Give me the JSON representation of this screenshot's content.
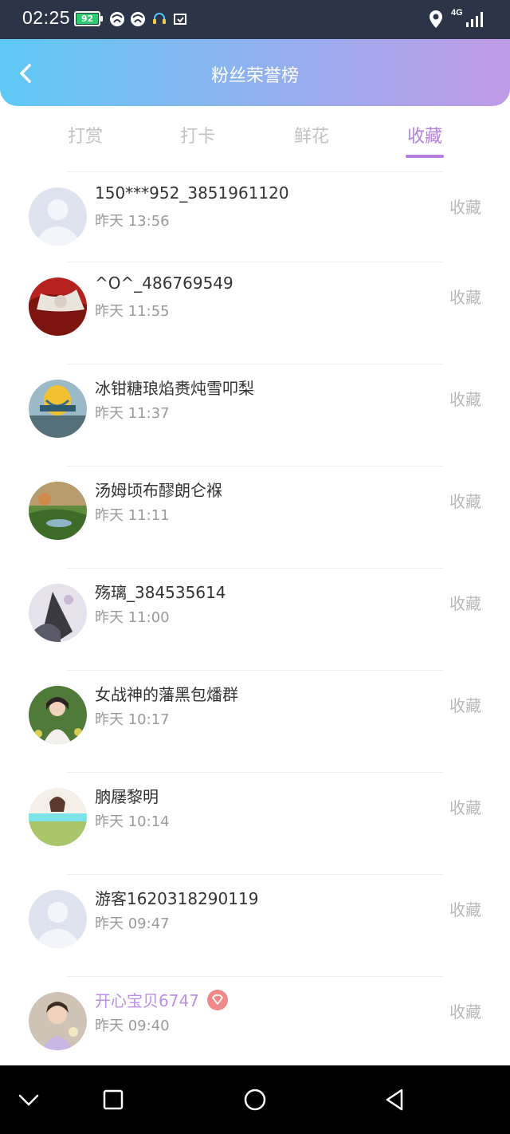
{
  "status_bar": {
    "time": "02:25",
    "battery_level": "92",
    "network": "4G",
    "battery_color": "#2ecc71"
  },
  "header": {
    "title": "粉丝荣誉榜",
    "gradient": [
      "#5ec9f4",
      "#8fb1ef",
      "#c09ae8"
    ]
  },
  "tabs": [
    {
      "label": "打赏",
      "active": false
    },
    {
      "label": "打卡",
      "active": false
    },
    {
      "label": "鲜花",
      "active": false
    },
    {
      "label": "收藏",
      "active": true
    }
  ],
  "accent_color": "#b57fe2",
  "list": [
    {
      "name": "150***952_3851961120",
      "time": "昨天 13:56",
      "action": "收藏",
      "avatar": "default-avatar"
    },
    {
      "name": "^O^_486769549",
      "time": "昨天 11:55",
      "action": "收藏",
      "avatar": "photo-red"
    },
    {
      "name": "冰钳糖琅焰赉炖雪叩梨",
      "time": "昨天 11:37",
      "action": "收藏",
      "avatar": "photo-balloon"
    },
    {
      "name": "汤姆顷布醪朗仑褓",
      "time": "昨天 11:11",
      "action": "收藏",
      "avatar": "photo-garden"
    },
    {
      "name": "殇璃_384535614",
      "time": "昨天 11:00",
      "action": "收藏",
      "avatar": "photo-wolf"
    },
    {
      "name": "女战神的藩黑包燔群",
      "time": "昨天 10:17",
      "action": "收藏",
      "avatar": "photo-girl-flowers"
    },
    {
      "name": "朒屦黎明",
      "time": "昨天 10:14",
      "action": "收藏",
      "avatar": "photo-girl-banner"
    },
    {
      "name": "游客1620318290119",
      "time": "昨天 09:47",
      "action": "收藏",
      "avatar": "default-avatar"
    },
    {
      "name": "开心宝贝6747",
      "time": "昨天 09:40",
      "action": "收藏",
      "avatar": "photo-child",
      "vip": true
    }
  ]
}
